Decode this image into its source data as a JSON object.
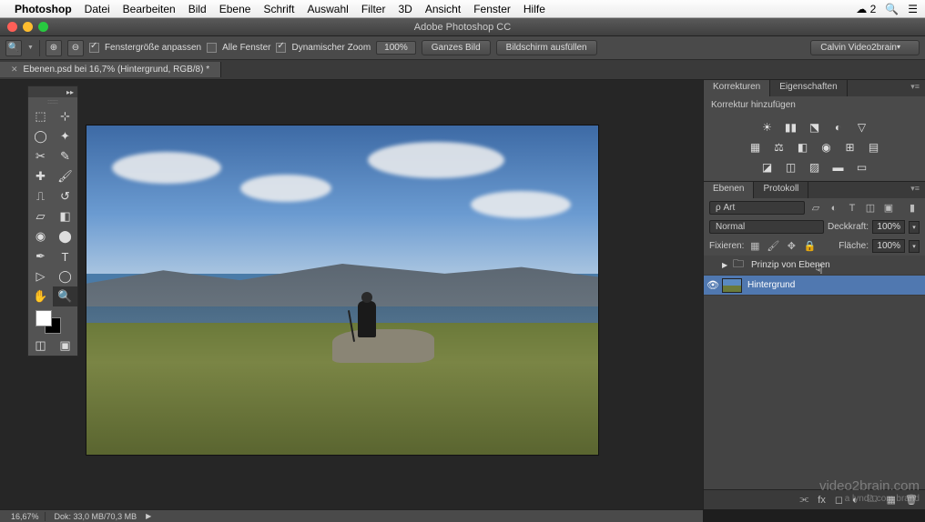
{
  "mac_menu": {
    "app": "Photoshop",
    "items": [
      "Datei",
      "Bearbeiten",
      "Bild",
      "Ebene",
      "Schrift",
      "Auswahl",
      "Filter",
      "3D",
      "Ansicht",
      "Fenster",
      "Hilfe"
    ],
    "cloud_count": "2"
  },
  "titlebar": {
    "title": "Adobe Photoshop CC"
  },
  "options": {
    "fenstergroesse": "Fenstergröße anpassen",
    "alle_fenster": "Alle Fenster",
    "dyn_zoom": "Dynamischer Zoom",
    "zoom_pct": "100%",
    "ganzes_bild": "Ganzes Bild",
    "bildschirm": "Bildschirm ausfüllen",
    "user": "Calvin Video2brain"
  },
  "doc_tab": {
    "label": "Ebenen.psd bei 16,7% (Hintergrund, RGB/8) *"
  },
  "korrekturen": {
    "tab1": "Korrekturen",
    "tab2": "Eigenschaften",
    "hinzu": "Korrektur hinzufügen"
  },
  "ebenen": {
    "tab1": "Ebenen",
    "tab2": "Protokoll",
    "filter": "ρ Art",
    "blend": "Normal",
    "deckkraft_label": "Deckkraft:",
    "deckkraft": "100%",
    "fix_label": "Fixieren:",
    "flaeche_label": "Fläche:",
    "flaeche": "100%",
    "group": "Prinzip von Ebenen",
    "bg": "Hintergrund"
  },
  "status": {
    "zoom": "16,67%",
    "dok": "Dok: 33,0 MB/70,3 MB"
  },
  "watermark": {
    "main": "video2brain.com",
    "sub": "a lynda.com brand"
  }
}
